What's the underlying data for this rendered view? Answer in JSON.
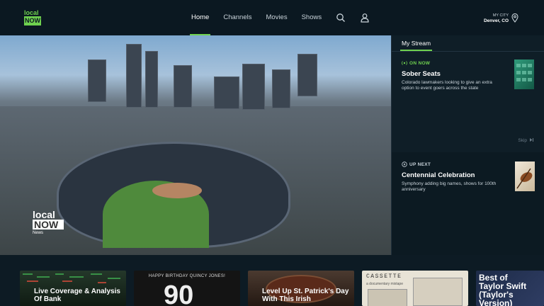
{
  "brand": {
    "line1": "local",
    "line2": "NOW"
  },
  "nav": [
    {
      "label": "Home",
      "active": true
    },
    {
      "label": "Channels",
      "active": false
    },
    {
      "label": "Movies",
      "active": false
    },
    {
      "label": "Shows",
      "active": false
    }
  ],
  "location": {
    "label": "MY CITY",
    "city": "Denver, CO"
  },
  "hero": {
    "watermark_line1": "local",
    "watermark_line2": "NOW",
    "watermark_line3": "News"
  },
  "stream": {
    "tab": "My Stream",
    "now": {
      "status": "ON NOW",
      "title": "Sober Seats",
      "desc": "Colorado lawmakers looking to give an extra option to event goers across the state"
    },
    "skip": "Skip",
    "next": {
      "status": "UP NEXT",
      "title": "Centennial Celebration",
      "desc": "Symphony adding big names, shows for 100th anniversary"
    }
  },
  "tiles": [
    {
      "text": "Live Coverage & Analysis Of Bank",
      "bg": "#1b2b21"
    },
    {
      "text": "HAPPY BIRTHDAY QUINCY JONES!",
      "bg": "#111"
    },
    {
      "text": "Level Up St. Patrick's Day With This Irish",
      "bg": "#3a2b24"
    },
    {
      "text": "CASSETTE",
      "bg": "#e8e3d6"
    },
    {
      "text": "Best of Taylor Swift (Taylor's Version)",
      "bg": "#1d2b48"
    }
  ],
  "tile_extra": {
    "cassette_sub": "a documentary mixtape",
    "quincy_number": "90"
  },
  "colors": {
    "accent": "#6fd14f",
    "background": "#0d1b24"
  }
}
